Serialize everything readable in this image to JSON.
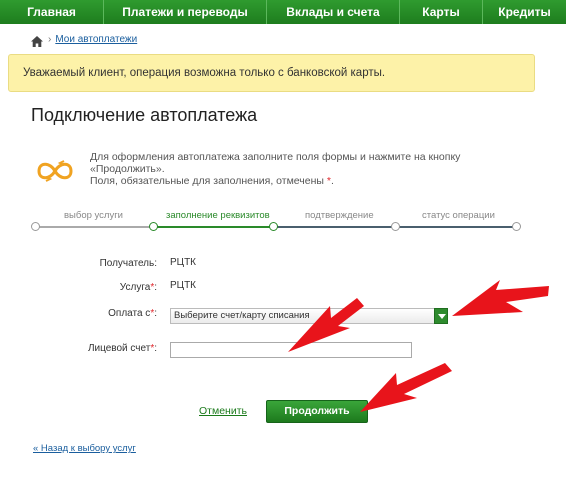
{
  "nav": {
    "items": [
      "Главная",
      "Платежи и переводы",
      "Вклады и счета",
      "Карты",
      "Кредиты"
    ]
  },
  "breadcrumb": {
    "separator": "›",
    "link": "Мои автоплатежи"
  },
  "alert": {
    "text": "Уважаемый клиент, операция возможна только с банковской карты."
  },
  "page": {
    "title": "Подключение автоплатежа"
  },
  "intro": {
    "line1": "Для оформления автоплатежа заполните поля формы и нажмите на кнопку «Продолжить».",
    "line2": "Поля, обязательные для заполнения, отмечены",
    "star": "*",
    "dot": "."
  },
  "steps": [
    {
      "label": "выбор услуги",
      "state": "done"
    },
    {
      "label": "заполнение реквизитов",
      "state": "active"
    },
    {
      "label": "подтверждение",
      "state": "pending"
    },
    {
      "label": "статус операции",
      "state": "pending"
    }
  ],
  "form": {
    "recipient_label": "Получатель:",
    "recipient_value": "РЦТК",
    "service_label": "Услуга",
    "service_value": "РЦТК",
    "payment_label": "Оплата с",
    "payment_select": "Выберите счет/карту списания",
    "account_label": "Лицевой счет",
    "required_star": "*",
    "colon": ":"
  },
  "actions": {
    "cancel": "Отменить",
    "continue": "Продолжить",
    "back": "« Назад к выбору услуг"
  },
  "colors": {
    "brand_green": "#1e7d1e",
    "alert_bg": "#fdf2a8",
    "annotation_arrow": "#e8141b",
    "required": "#e0262b",
    "step_done": "#aaaaaa",
    "step_active": "#2a8a2a",
    "step_pending": "#4a5f6e"
  },
  "icons": {
    "home": "home-icon",
    "autopay": "infinity-autopay-icon",
    "select_arrow": "chevron-down-icon"
  }
}
